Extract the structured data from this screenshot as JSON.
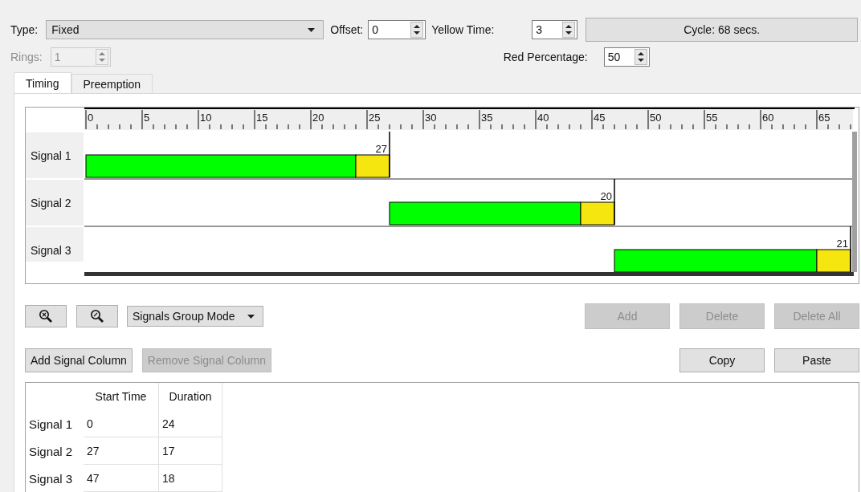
{
  "type_field": {
    "label": "Type:",
    "value": "Fixed"
  },
  "offset": {
    "label": "Offset:",
    "value": "0"
  },
  "yellow_time": {
    "label": "Yellow Time:",
    "value": "3"
  },
  "cycle_button": {
    "label": "Cycle: 68 secs."
  },
  "rings": {
    "label": "Rings:",
    "value": "1",
    "disabled": true
  },
  "red_percentage": {
    "label": "Red Percentage:",
    "value": "50"
  },
  "tabs": [
    {
      "label": "Timing",
      "selected": true
    },
    {
      "label": "Preemption",
      "selected": false
    }
  ],
  "timing_diagram": {
    "ruler_labels": [
      "0",
      "5",
      "10",
      "15",
      "20",
      "25",
      "30",
      "35",
      "40",
      "45",
      "50",
      "55",
      "60",
      "65"
    ],
    "signals": [
      {
        "label": "Signal 1",
        "end_label": "27"
      },
      {
        "label": "Signal 2",
        "end_label": "20"
      },
      {
        "label": "Signal 3",
        "end_label": "21"
      }
    ]
  },
  "toolbar": {
    "mode_dropdown": "Signals Group Mode",
    "buttons": [
      {
        "label": "Add",
        "disabled": true
      },
      {
        "label": "Delete",
        "disabled": true
      },
      {
        "label": "Delete All",
        "disabled": true
      }
    ]
  },
  "column_buttons": [
    {
      "label": "Add Signal Column",
      "disabled": false
    },
    {
      "label": "Remove Signal Column",
      "disabled": true
    }
  ],
  "clipboard_buttons": [
    {
      "label": "Copy",
      "disabled": false
    },
    {
      "label": "Paste",
      "disabled": false
    }
  ],
  "signal_table": {
    "start_time_heading": "Start Time",
    "duration_heading": "Duration",
    "entries": [
      {
        "signal": "Signal 1",
        "start_time": "0",
        "duration": "24"
      },
      {
        "signal": "Signal 2",
        "start_time": "27",
        "duration": "17"
      },
      {
        "signal": "Signal 3",
        "start_time": "47",
        "duration": "18"
      }
    ]
  }
}
